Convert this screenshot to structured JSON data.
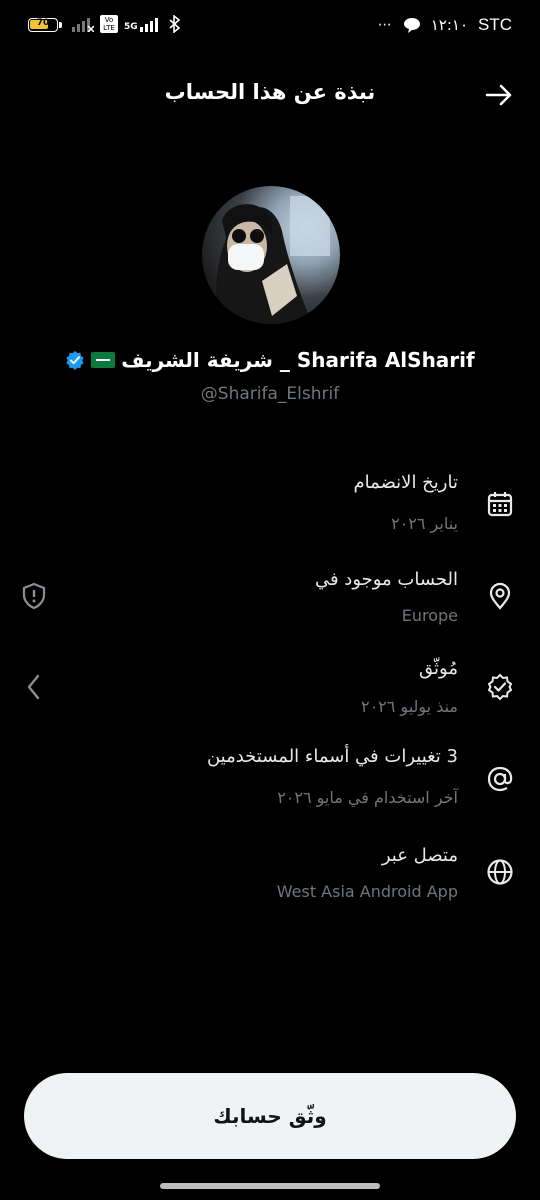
{
  "status_bar": {
    "battery": "70",
    "battery_level": 0.7,
    "network": "5G",
    "volte": "Vo LTE",
    "time": "١٢:١٠",
    "carrier": "STC"
  },
  "header": {
    "title": "نبذة عن هذا الحساب"
  },
  "profile": {
    "name": "Sharifa AlSharif _ شريفة الشريف",
    "handle": "@Sharifa_Elshrif"
  },
  "rows": [
    {
      "title": "تاريخ الانضمام",
      "sub": "يناير ٢٠٢٦",
      "icon": "calendar-icon"
    },
    {
      "title": "الحساب موجود في",
      "sub": "Europe",
      "icon": "location-pin-icon"
    },
    {
      "title": "مُوثّق",
      "sub": "منذ يوليو ٢٠٢٦",
      "icon": "verified-badge-icon"
    },
    {
      "title": "3 تغييرات في أسماء المستخدمين",
      "sub": "آخر استخدام في مايو ٢٠٢٦",
      "icon": "at-sign-icon"
    },
    {
      "title": "متصل عبر",
      "sub": "West Asia Android App",
      "icon": "globe-icon"
    }
  ],
  "cta": {
    "label": "وثّق حسابك"
  },
  "colors": {
    "background": "#000000",
    "verified_blue": "#1d9bf0",
    "muted": "#71767b"
  }
}
